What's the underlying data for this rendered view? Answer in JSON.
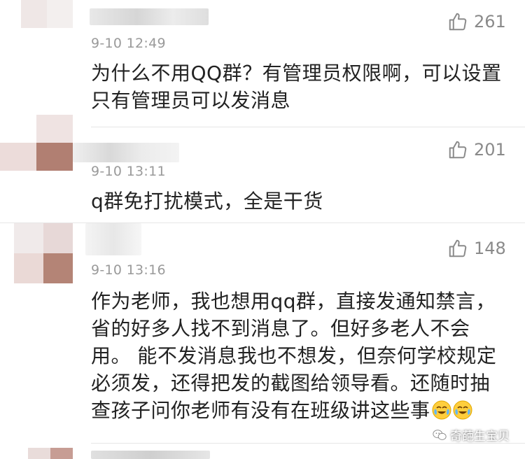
{
  "comments": [
    {
      "time": "9-10 12:49",
      "likes": "261",
      "text_lines": [
        "为什么不用QQ群？有管理员权限啊，可以设置",
        "只有管理员可以发消息"
      ]
    },
    {
      "time": "9-10 13:11",
      "likes": "201",
      "text_lines": [
        "q群免打扰模式，全是干货"
      ]
    },
    {
      "time": "9-10 13:16",
      "likes": "148",
      "text_lines": [
        "作为老师，我也想用qq群，直接发通知禁言，",
        "省的好多人找不到消息了。但好多老人不会",
        "用。 能不发消息我也不想发，但奈何学校规定",
        "必须发，还得把发的截图给领导看。还随时抽",
        "查孩子问你老师有没有在班级讲这些事"
      ]
    }
  ],
  "watermark": {
    "text": "奇葩生宝贝"
  },
  "colors": {
    "time": "#9a9a9a",
    "like": "#8a8a8a",
    "text": "#222222",
    "divider": "#e6e6e6"
  },
  "icons": [
    "thumbs-up-icon",
    "crying-laughing-emoji",
    "watermark-logo-icon"
  ]
}
